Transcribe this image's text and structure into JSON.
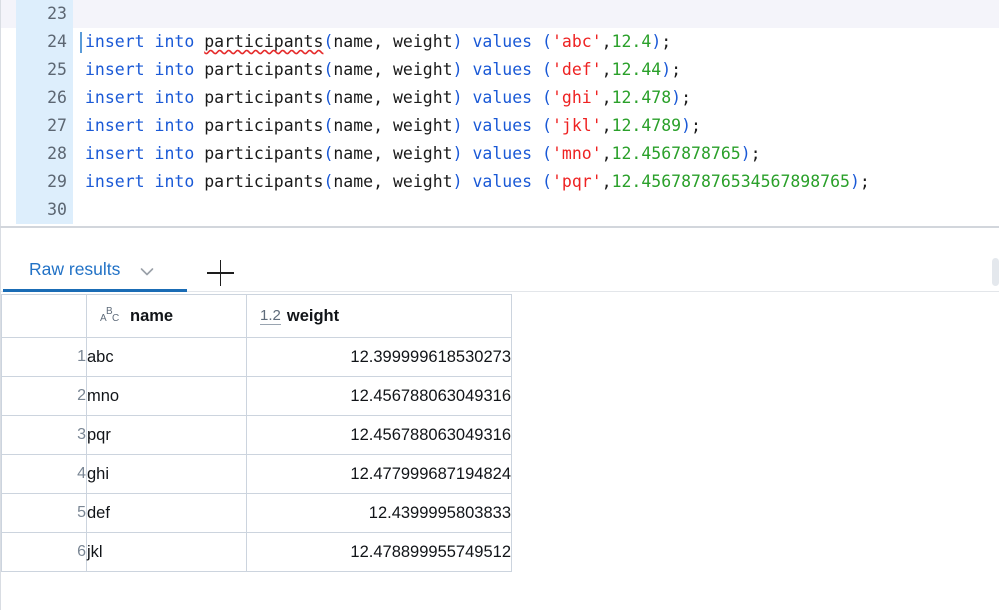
{
  "editor": {
    "lines": [
      {
        "number": "23",
        "highlighted": true,
        "caret": false,
        "tokens": []
      },
      {
        "number": "24",
        "highlighted": false,
        "caret": true,
        "tokens": [
          {
            "t": "kw",
            "v": "insert into "
          },
          {
            "t": "id",
            "v": "participants",
            "squiggly": true
          },
          {
            "t": "pn",
            "v": "("
          },
          {
            "t": "pun",
            "v": "name, weight"
          },
          {
            "t": "pn",
            "v": ")"
          },
          {
            "t": "kw",
            "v": " values "
          },
          {
            "t": "pn",
            "v": "("
          },
          {
            "t": "str",
            "v": "'abc'"
          },
          {
            "t": "pun",
            "v": ","
          },
          {
            "t": "num",
            "v": "12.4"
          },
          {
            "t": "pn",
            "v": ")"
          },
          {
            "t": "pun",
            "v": ";"
          }
        ]
      },
      {
        "number": "25",
        "highlighted": false,
        "caret": false,
        "tokens": [
          {
            "t": "kw",
            "v": "insert into "
          },
          {
            "t": "id",
            "v": "participants"
          },
          {
            "t": "pn",
            "v": "("
          },
          {
            "t": "pun",
            "v": "name, weight"
          },
          {
            "t": "pn",
            "v": ")"
          },
          {
            "t": "kw",
            "v": " values "
          },
          {
            "t": "pn",
            "v": "("
          },
          {
            "t": "str",
            "v": "'def'"
          },
          {
            "t": "pun",
            "v": ","
          },
          {
            "t": "num",
            "v": "12.44"
          },
          {
            "t": "pn",
            "v": ")"
          },
          {
            "t": "pun",
            "v": ";"
          }
        ]
      },
      {
        "number": "26",
        "highlighted": false,
        "caret": false,
        "tokens": [
          {
            "t": "kw",
            "v": "insert into "
          },
          {
            "t": "id",
            "v": "participants"
          },
          {
            "t": "pn",
            "v": "("
          },
          {
            "t": "pun",
            "v": "name, weight"
          },
          {
            "t": "pn",
            "v": ")"
          },
          {
            "t": "kw",
            "v": " values "
          },
          {
            "t": "pn",
            "v": "("
          },
          {
            "t": "str",
            "v": "'ghi'"
          },
          {
            "t": "pun",
            "v": ","
          },
          {
            "t": "num",
            "v": "12.478"
          },
          {
            "t": "pn",
            "v": ")"
          },
          {
            "t": "pun",
            "v": ";"
          }
        ]
      },
      {
        "number": "27",
        "highlighted": false,
        "caret": false,
        "tokens": [
          {
            "t": "kw",
            "v": "insert into "
          },
          {
            "t": "id",
            "v": "participants"
          },
          {
            "t": "pn",
            "v": "("
          },
          {
            "t": "pun",
            "v": "name, weight"
          },
          {
            "t": "pn",
            "v": ")"
          },
          {
            "t": "kw",
            "v": " values "
          },
          {
            "t": "pn",
            "v": "("
          },
          {
            "t": "str",
            "v": "'jkl'"
          },
          {
            "t": "pun",
            "v": ","
          },
          {
            "t": "num",
            "v": "12.4789"
          },
          {
            "t": "pn",
            "v": ")"
          },
          {
            "t": "pun",
            "v": ";"
          }
        ]
      },
      {
        "number": "28",
        "highlighted": false,
        "caret": false,
        "tokens": [
          {
            "t": "kw",
            "v": "insert into "
          },
          {
            "t": "id",
            "v": "participants"
          },
          {
            "t": "pn",
            "v": "("
          },
          {
            "t": "pun",
            "v": "name, weight"
          },
          {
            "t": "pn",
            "v": ")"
          },
          {
            "t": "kw",
            "v": " values "
          },
          {
            "t": "pn",
            "v": "("
          },
          {
            "t": "str",
            "v": "'mno'"
          },
          {
            "t": "pun",
            "v": ","
          },
          {
            "t": "num",
            "v": "12.4567878765"
          },
          {
            "t": "pn",
            "v": ")"
          },
          {
            "t": "pun",
            "v": ";"
          }
        ]
      },
      {
        "number": "29",
        "highlighted": false,
        "caret": false,
        "tokens": [
          {
            "t": "kw",
            "v": "insert into "
          },
          {
            "t": "id",
            "v": "participants"
          },
          {
            "t": "pn",
            "v": "("
          },
          {
            "t": "pun",
            "v": "name, weight"
          },
          {
            "t": "pn",
            "v": ")"
          },
          {
            "t": "kw",
            "v": " values "
          },
          {
            "t": "pn",
            "v": "("
          },
          {
            "t": "str",
            "v": "'pqr'"
          },
          {
            "t": "pun",
            "v": ","
          },
          {
            "t": "num",
            "v": "12.456787876534567898765"
          },
          {
            "t": "pn",
            "v": ")"
          },
          {
            "t": "pun",
            "v": ";"
          }
        ]
      },
      {
        "number": "30",
        "highlighted": false,
        "caret": false,
        "tokens": []
      }
    ],
    "colors": {
      "keyword": "#1a59d6",
      "string": "#ee2222",
      "number": "#2aa02a",
      "identifier": "#1a1a1a",
      "gutter_background": "#ddeefc",
      "current_line_background": "#f4f4fa",
      "error_squiggle": "#e52b2b"
    }
  },
  "results_panel": {
    "tab": {
      "label": "Raw results",
      "dropdown_icon": "chevron-down-icon",
      "active": true,
      "accent_color": "#1a6cb5"
    },
    "add_tab_icon": "plus-icon",
    "table": {
      "columns": [
        {
          "key": "rownum",
          "header": "",
          "type_icon": ""
        },
        {
          "key": "name",
          "header": "name",
          "type_icon": "abc-text-type-icon"
        },
        {
          "key": "weight",
          "header": "weight",
          "type_icon": "1.2"
        }
      ],
      "rows": [
        {
          "num": "1",
          "name": "abc",
          "weight": "12.399999618530273"
        },
        {
          "num": "2",
          "name": "mno",
          "weight": "12.456788063049316"
        },
        {
          "num": "3",
          "name": "pqr",
          "weight": "12.456788063049316"
        },
        {
          "num": "4",
          "name": "ghi",
          "weight": "12.477999687194824"
        },
        {
          "num": "5",
          "name": "def",
          "weight": "12.4399995803833"
        },
        {
          "num": "6",
          "name": "jkl",
          "weight": "12.478899955749512"
        }
      ]
    }
  }
}
